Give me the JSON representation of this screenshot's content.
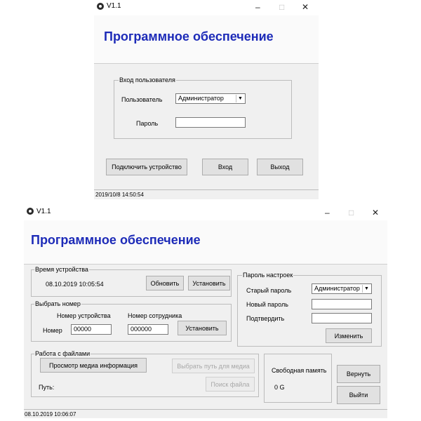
{
  "login_window": {
    "title": "V1.1",
    "controls": {
      "minimize": "–",
      "maximize": "□",
      "close": "✕"
    },
    "heading": "Программное обеспечение",
    "login_group": {
      "legend": "Вход пользователя",
      "user_label": "Пользователь",
      "user_value": "Администратор",
      "password_label": "Пароль",
      "password_value": ""
    },
    "buttons": {
      "connect": "Подключить устройство",
      "login": "Вход",
      "exit": "Выход"
    },
    "status": "2019/10/8 14:50:54"
  },
  "main_window": {
    "title": "V1.1",
    "controls": {
      "minimize": "–",
      "maximize": "□",
      "close": "✕"
    },
    "heading": "Программное обеспечение",
    "device_time": {
      "legend": "Время устройства",
      "value": "08.10.2019 10:05:54",
      "refresh_button": "Обновить",
      "set_button": "Установить"
    },
    "select_number": {
      "legend": "Выбрать номер",
      "device_number_label": "Номер устройства",
      "employee_number_label": "Номер сотрудника",
      "number_label": "Номер",
      "device_number_value": "00000",
      "employee_number_value": "000000",
      "set_button": "Установить"
    },
    "settings_password": {
      "legend": "Пароль настроек",
      "old_label": "Старый пароль",
      "new_label": "Новый пароль",
      "confirm_label": "Подтвердить",
      "user_value": "Администратор",
      "new_value": "",
      "confirm_value": "",
      "change_button": "Изменить"
    },
    "files": {
      "legend": "Работа с файлами",
      "view_media_button": "Просмотр медиа информация",
      "choose_path_button": "Выбрать путь для медиа",
      "find_file_button": "Поиск файла",
      "path_label": "Путь:",
      "path_value": ""
    },
    "memory": {
      "label": "Свободная память",
      "value": "0 G"
    },
    "buttons": {
      "return": "Вернуть",
      "exit": "Выйти"
    },
    "status": "08.10.2019 10:06:07"
  }
}
